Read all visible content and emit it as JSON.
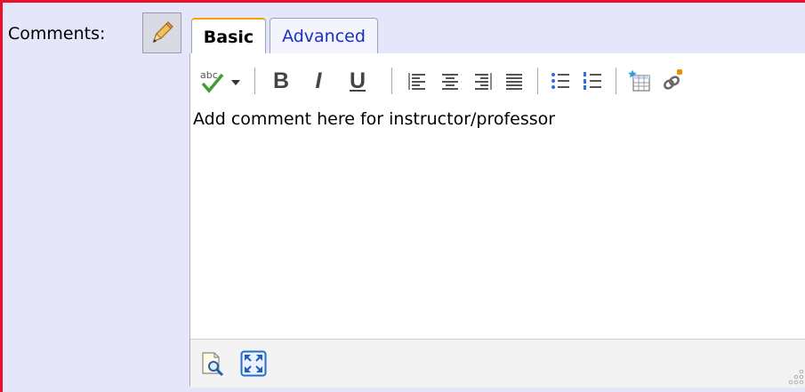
{
  "comments": {
    "label": "Comments:"
  },
  "tabs": [
    {
      "label": "Basic",
      "active": true
    },
    {
      "label": "Advanced",
      "active": false
    }
  ],
  "editor": {
    "content": "Add comment here for instructor/professor",
    "toolbar": {
      "spellcheck": "spellcheck-icon",
      "bold": "B",
      "italic": "I",
      "underline": "U",
      "align": [
        "align-left-icon",
        "align-center-icon",
        "align-right-icon",
        "align-justify-icon"
      ],
      "lists": [
        "bulleted-list-icon",
        "numbered-list-icon"
      ],
      "insert": [
        "insert-table-icon",
        "insert-link-icon"
      ]
    },
    "footer": [
      "preview-icon",
      "fullscreen-icon",
      "resize-grip-icon"
    ]
  },
  "colors": {
    "frame_border": "#e8102a",
    "panel_bg": "#e6e6fa",
    "tab_link": "#1a2fc8",
    "active_tab_accent": "#f0a800"
  }
}
